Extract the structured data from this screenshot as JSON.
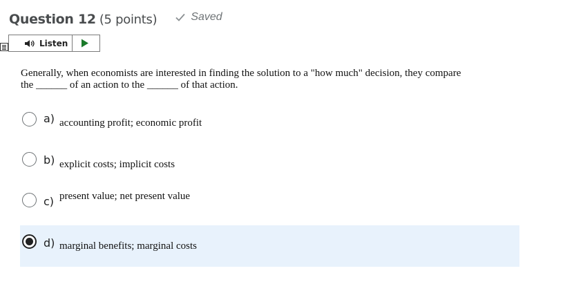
{
  "question": {
    "title": "Question 12",
    "points": "(5 points)",
    "status": "Saved",
    "status_icon": "check-icon"
  },
  "toolbar": {
    "listen_label": "Listen",
    "menu_icon": "menu-icon",
    "speaker_icon": "speaker-icon",
    "play_icon": "play-icon"
  },
  "prompt": {
    "line1": "Generally, when economists are interested in finding the solution to a \"how much\" decision, they compare",
    "line2_part1": "the ",
    "blank1": "______",
    "line2_part2": " of an action to the ",
    "blank2": "______",
    "line2_part3": " of that action."
  },
  "options": [
    {
      "letter": "a)",
      "text": "accounting profit; economic profit",
      "selected": false
    },
    {
      "letter": "b)",
      "text": "explicit costs; implicit costs",
      "selected": false
    },
    {
      "letter": "c)",
      "text": "present value; net present value",
      "selected": false
    },
    {
      "letter": "d)",
      "text": "marginal benefits; marginal costs",
      "selected": true
    }
  ],
  "colors": {
    "selected_background": "#e8f2fc",
    "title_text": "#494c4e",
    "saved_text": "#6e7376"
  }
}
